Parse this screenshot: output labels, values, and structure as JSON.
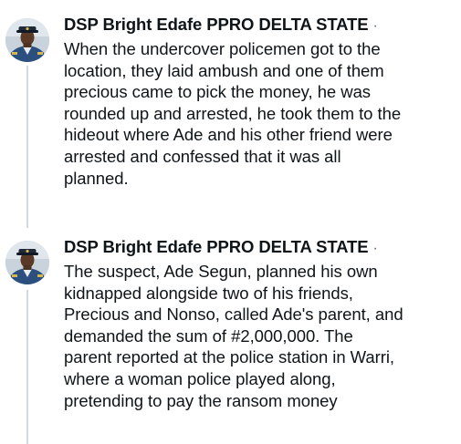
{
  "tweets": [
    {
      "author": "DSP Bright Edafe PPRO DELTA STATE",
      "separator": "·",
      "avatar_icon": "police-officer-avatar",
      "lines": [
        "When the undercover policemen got to the",
        "location, they laid ambush and one of them",
        "precious came to pick the money, he was",
        "rounded up and arrested, he took them to the",
        "hideout where Ade and his other friend were",
        "arrested and confessed that it was all",
        "planned."
      ]
    },
    {
      "author": "DSP Bright Edafe PPRO DELTA STATE",
      "separator": "·",
      "avatar_icon": "police-officer-avatar",
      "lines": [
        "The suspect, Ade Segun, planned his own",
        "kidnapped alongside two of his friends,",
        "Precious and Nonso, called Ade's parent, and",
        "demanded the sum of #2,000,000. The",
        "parent reported at the police station in Warri,",
        "where a woman police played along,",
        "pretending to pay the ransom money"
      ]
    }
  ],
  "colors": {
    "text": "#0f1419",
    "secondary": "#536471",
    "thread_line": "#cfd9de",
    "uniform": "#2b4f7e"
  }
}
